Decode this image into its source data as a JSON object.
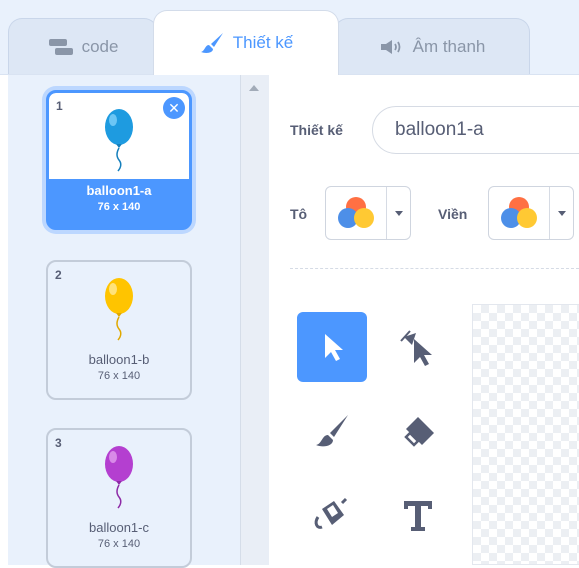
{
  "tabs": {
    "code": "code",
    "design": "Thiết kế",
    "sound": "Âm thanh"
  },
  "costumes": [
    {
      "number": "1",
      "name": "balloon1-a",
      "size": "76 x 140",
      "color": "#1e9be0",
      "selected": true
    },
    {
      "number": "2",
      "name": "balloon1-b",
      "size": "76 x 140",
      "color": "#ffc400",
      "selected": false
    },
    {
      "number": "3",
      "name": "balloon1-c",
      "size": "76 x 140",
      "color": "#b43fd0",
      "selected": false
    }
  ],
  "editor": {
    "costume_label": "Thiết kế",
    "costume_name": "balloon1-a",
    "fill_label": "Tô",
    "outline_label": "Viền"
  },
  "tools": [
    "select-tool",
    "reshape-tool",
    "brush-tool",
    "eraser-tool",
    "fill-tool",
    "text-tool"
  ],
  "colors": {
    "accent": "#4c97ff",
    "text": "#575e75",
    "panel": "#e9f1fc"
  }
}
